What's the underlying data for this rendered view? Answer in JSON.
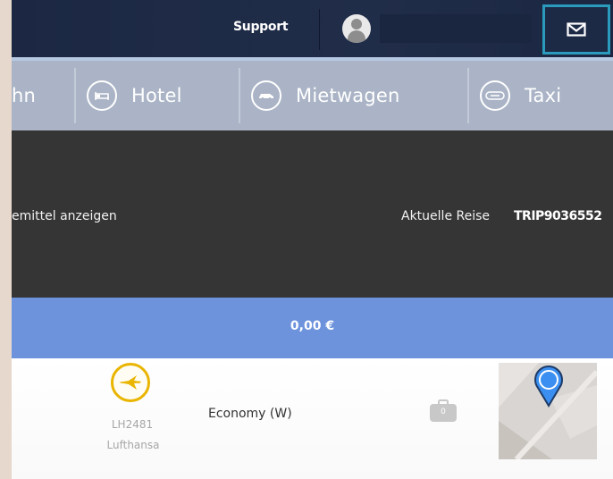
{
  "header": {
    "support_label": "Support",
    "icons": {
      "avatar": "user-avatar-icon",
      "mail": "envelope-icon"
    }
  },
  "nav": {
    "tabs": [
      {
        "label": "hn",
        "icon": "train-icon"
      },
      {
        "label": "Hotel",
        "icon": "bed-icon"
      },
      {
        "label": "Mietwagen",
        "icon": "car-icon"
      },
      {
        "label": "Taxi",
        "icon": "taxi-icon"
      }
    ]
  },
  "trip": {
    "transport_link": "emittel anzeigen",
    "current_trip_label": "Aktuelle Reise",
    "current_trip_id": "TRIP9036552"
  },
  "summary": {
    "price": "0,00 €"
  },
  "flight": {
    "flight_number": "LH2481",
    "airline": "Lufthansa",
    "cabin_class": "Economy (W)",
    "baggage_count": "0",
    "icons": {
      "airline": "crane-logo-icon",
      "baggage": "suitcase-icon",
      "map": "map-pin-icon"
    }
  },
  "colors": {
    "header_bg": "#1f2b47",
    "nav_bg": "#aab4c6",
    "dark_panel": "#353535",
    "price_bar": "#6e93dd",
    "focus_ring": "#2a9bbd",
    "lufthansa_yellow": "#e9b500",
    "map_pin": "#3a8ff0"
  }
}
